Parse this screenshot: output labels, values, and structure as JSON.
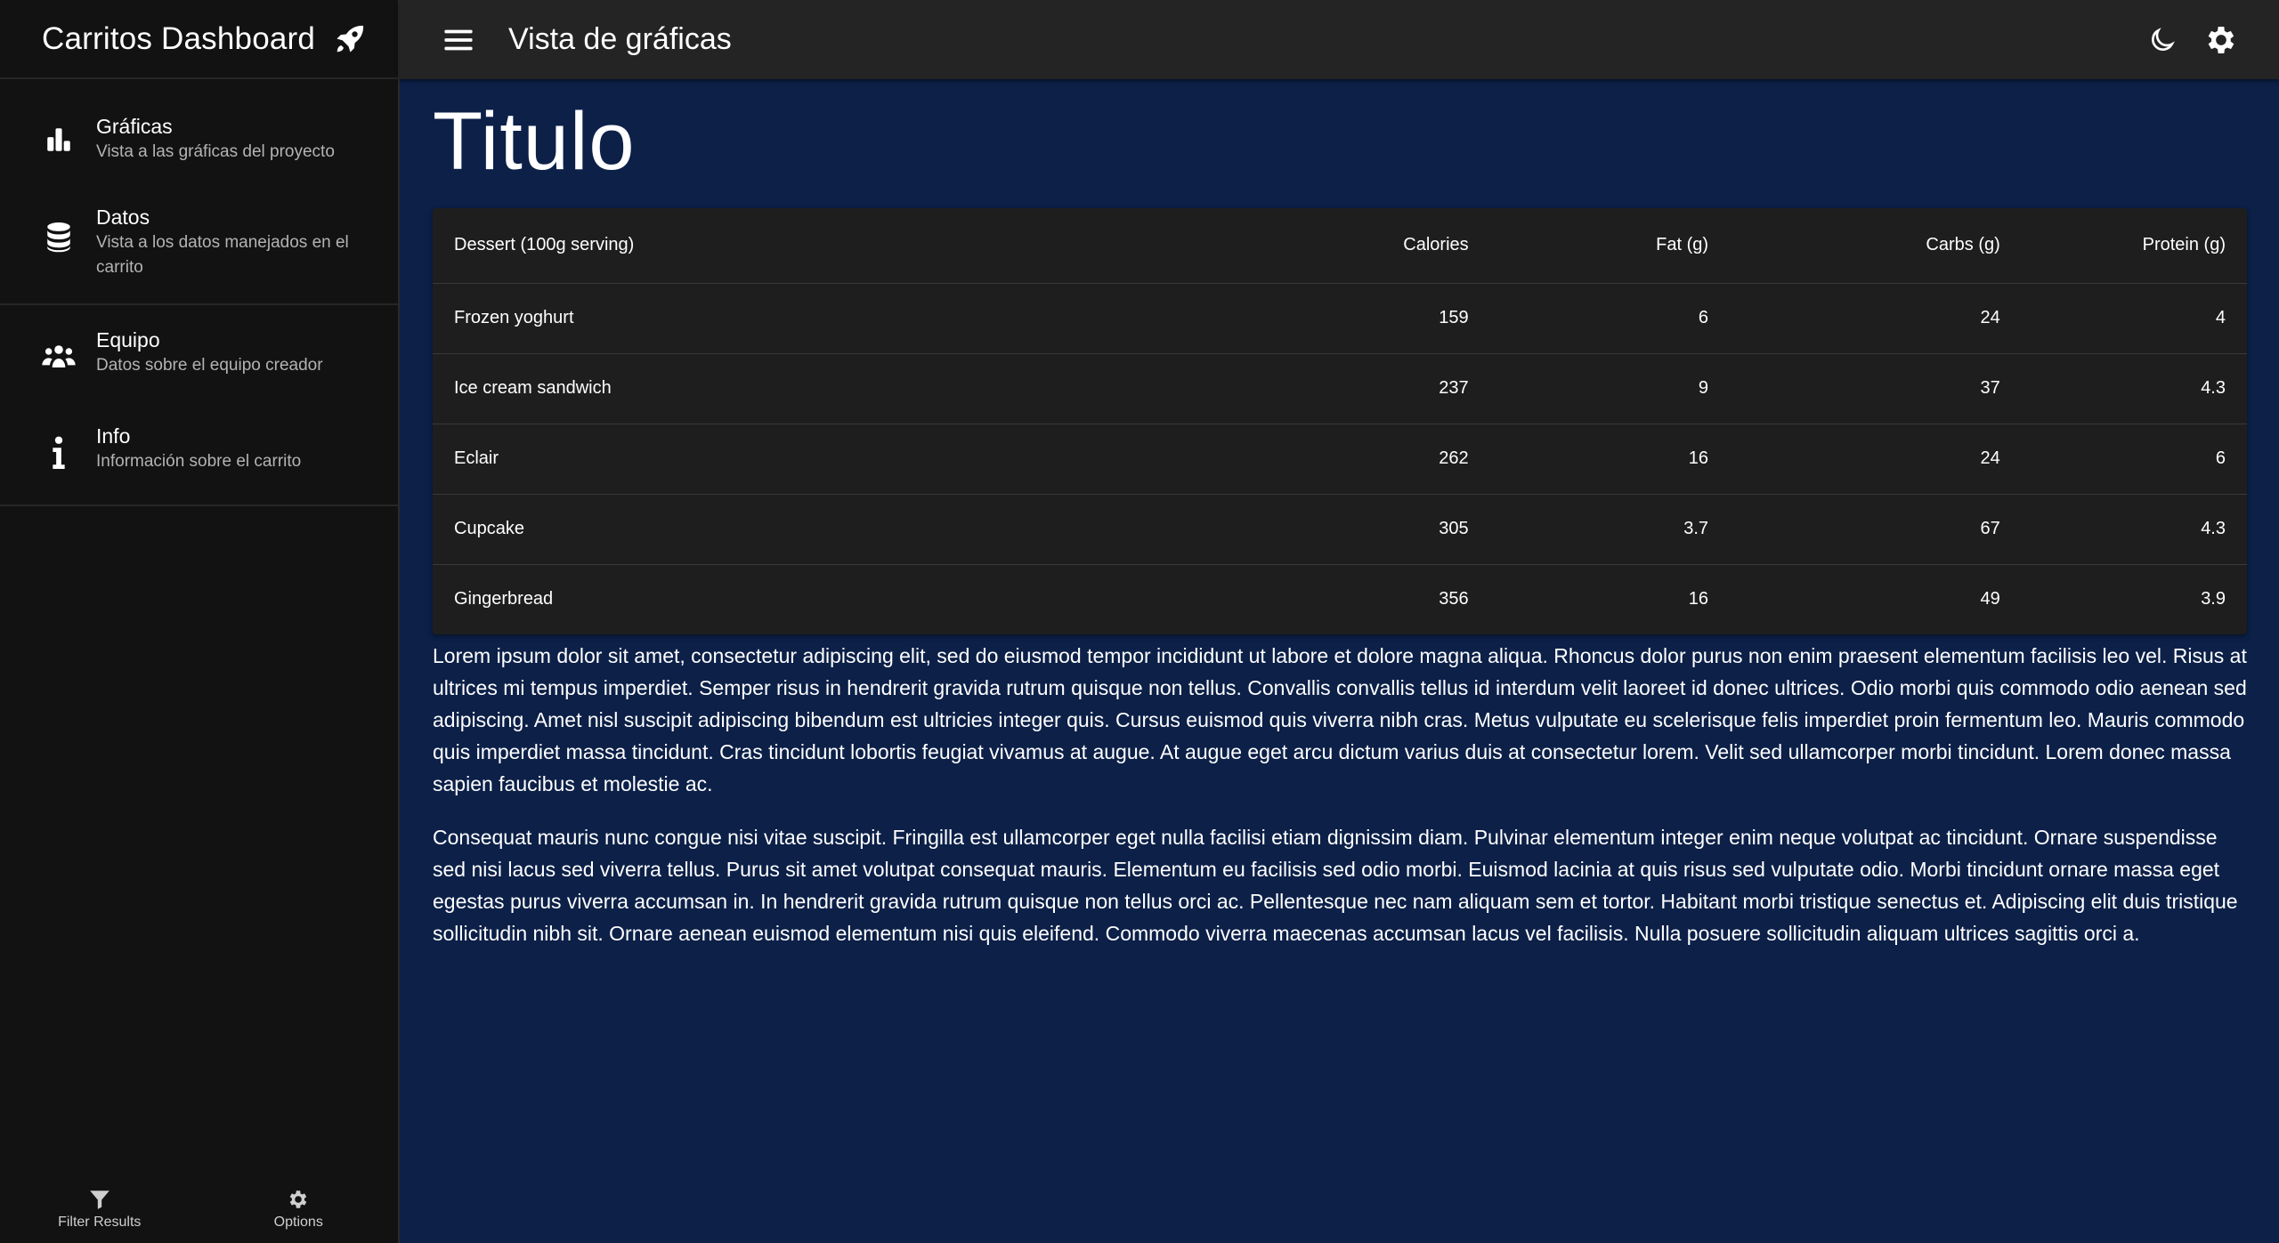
{
  "sidebar": {
    "title": "Carritos Dashboard",
    "items": [
      {
        "title": "Gráficas",
        "subtitle": "Vista a las gráficas del proyecto",
        "icon": "bar-chart-icon"
      },
      {
        "title": "Datos",
        "subtitle": "Vista a los datos manejados en el carrito",
        "icon": "database-icon"
      },
      {
        "title": "Equipo",
        "subtitle": "Datos sobre el equipo creador",
        "icon": "people-icon"
      },
      {
        "title": "Info",
        "subtitle": "Información sobre el carrito",
        "icon": "info-icon"
      }
    ],
    "bottom": [
      {
        "label": "Filter Results",
        "icon": "filter-icon"
      },
      {
        "label": "Options",
        "icon": "gear-icon"
      }
    ]
  },
  "topbar": {
    "title": "Vista de gráficas",
    "actions": [
      "moon-icon",
      "gear-icon"
    ]
  },
  "main": {
    "heading": "Titulo",
    "table": {
      "headers": [
        "Dessert (100g serving)",
        "Calories",
        "Fat (g)",
        "Carbs (g)",
        "Protein (g)"
      ],
      "rows": [
        [
          "Frozen yoghurt",
          "159",
          "6",
          "24",
          "4"
        ],
        [
          "Ice cream sandwich",
          "237",
          "9",
          "37",
          "4.3"
        ],
        [
          "Eclair",
          "262",
          "16",
          "24",
          "6"
        ],
        [
          "Cupcake",
          "305",
          "3.7",
          "67",
          "4.3"
        ],
        [
          "Gingerbread",
          "356",
          "16",
          "49",
          "3.9"
        ]
      ]
    },
    "paragraphs": [
      "Lorem ipsum dolor sit amet, consectetur adipiscing elit, sed do eiusmod tempor incididunt ut labore et dolore magna aliqua. Rhoncus dolor purus non enim praesent elementum facilisis leo vel. Risus at ultrices mi tempus imperdiet. Semper risus in hendrerit gravida rutrum quisque non tellus. Convallis convallis tellus id interdum velit laoreet id donec ultrices. Odio morbi quis commodo odio aenean sed adipiscing. Amet nisl suscipit adipiscing bibendum est ultricies integer quis. Cursus euismod quis viverra nibh cras. Metus vulputate eu scelerisque felis imperdiet proin fermentum leo. Mauris commodo quis imperdiet massa tincidunt. Cras tincidunt lobortis feugiat vivamus at augue. At augue eget arcu dictum varius duis at consectetur lorem. Velit sed ullamcorper morbi tincidunt. Lorem donec massa sapien faucibus et molestie ac.",
      "Consequat mauris nunc congue nisi vitae suscipit. Fringilla est ullamcorper eget nulla facilisi etiam dignissim diam. Pulvinar elementum integer enim neque volutpat ac tincidunt. Ornare suspendisse sed nisi lacus sed viverra tellus. Purus sit amet volutpat consequat mauris. Elementum eu facilisis sed odio morbi. Euismod lacinia at quis risus sed vulputate odio. Morbi tincidunt ornare massa eget egestas purus viverra accumsan in. In hendrerit gravida rutrum quisque non tellus orci ac. Pellentesque nec nam aliquam sem et tortor. Habitant morbi tristique senectus et. Adipiscing elit duis tristique sollicitudin nibh sit. Ornare aenean euismod elementum nisi quis eleifend. Commodo viverra maecenas accumsan lacus vel facilisis. Nulla posuere sollicitudin aliquam ultrices sagittis orci a."
    ]
  },
  "colors": {
    "main_background": "#0c2048",
    "sidebar_background": "#121212",
    "topbar_background": "#242424",
    "table_background": "#1e1e1e"
  }
}
